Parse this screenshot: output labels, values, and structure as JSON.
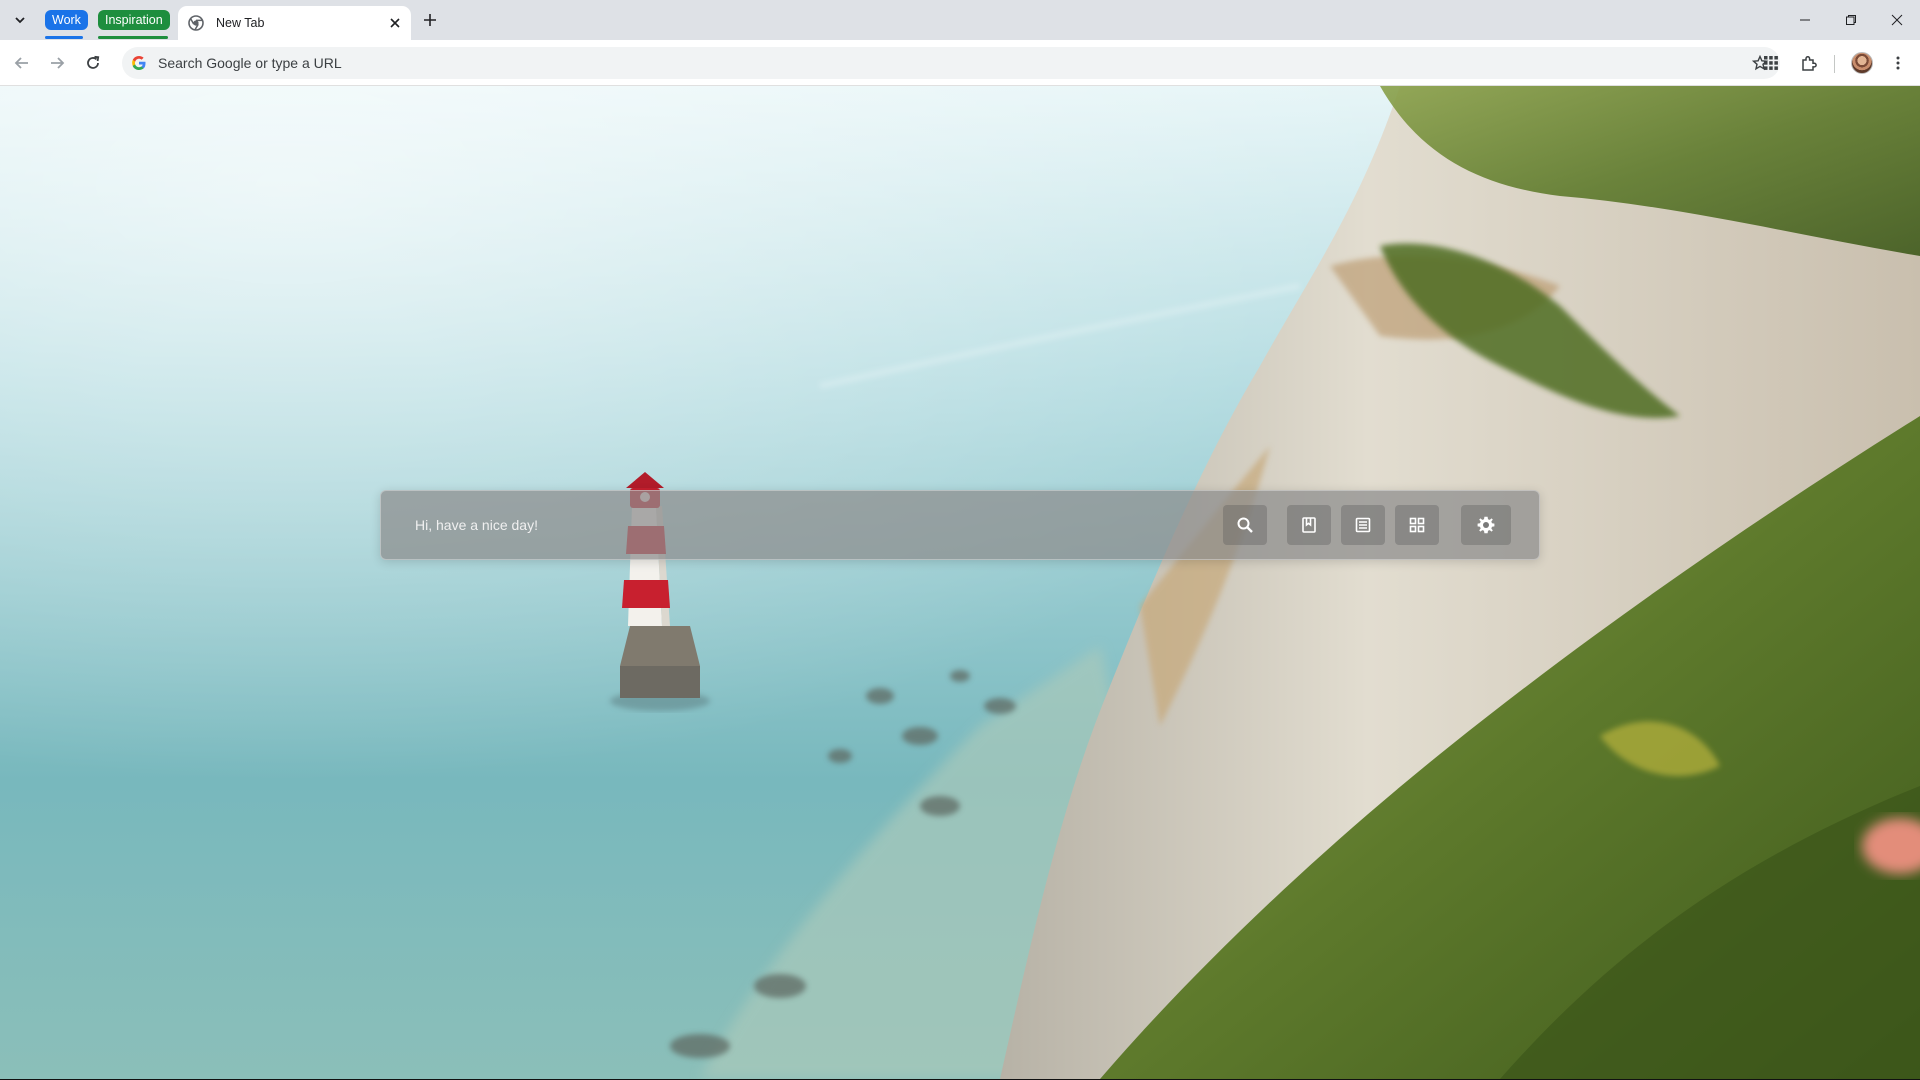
{
  "tabs": {
    "groups": [
      {
        "label": "Work",
        "color": "#1a73e8"
      },
      {
        "label": "Inspiration",
        "color": "#1e8e3e"
      }
    ],
    "active_tab": {
      "title": "New Tab",
      "favicon": "chrome-icon"
    },
    "new_tab_icon": "plus-icon",
    "tab_search_icon": "chevron-down-icon"
  },
  "window_controls": {
    "minimize_icon": "minimize-icon",
    "maximize_icon": "restore-icon",
    "close_icon": "close-icon"
  },
  "toolbar": {
    "omnibox_placeholder": "Search Google or type a URL",
    "icons": [
      "back-arrow-icon",
      "forward-arrow-icon",
      "reload-icon",
      "google-g-icon",
      "star-icon",
      "apps-grid-icon",
      "extensions-icon",
      "profile-avatar",
      "menu-icon"
    ]
  },
  "widget": {
    "placeholder": "Hi, have a nice day!",
    "buttons": [
      "search-icon",
      "bookmark-icon",
      "reader-icon",
      "apps-grid-icon",
      "gear-icon"
    ]
  },
  "colors": {
    "tabstrip_bg": "#dee1e6",
    "toolbar_bg": "#ffffff",
    "sea": "#7fbcc2",
    "cliff": "#d9d3c4",
    "grass": "#6f8f3a",
    "lighthouse_red": "#c8202f"
  }
}
